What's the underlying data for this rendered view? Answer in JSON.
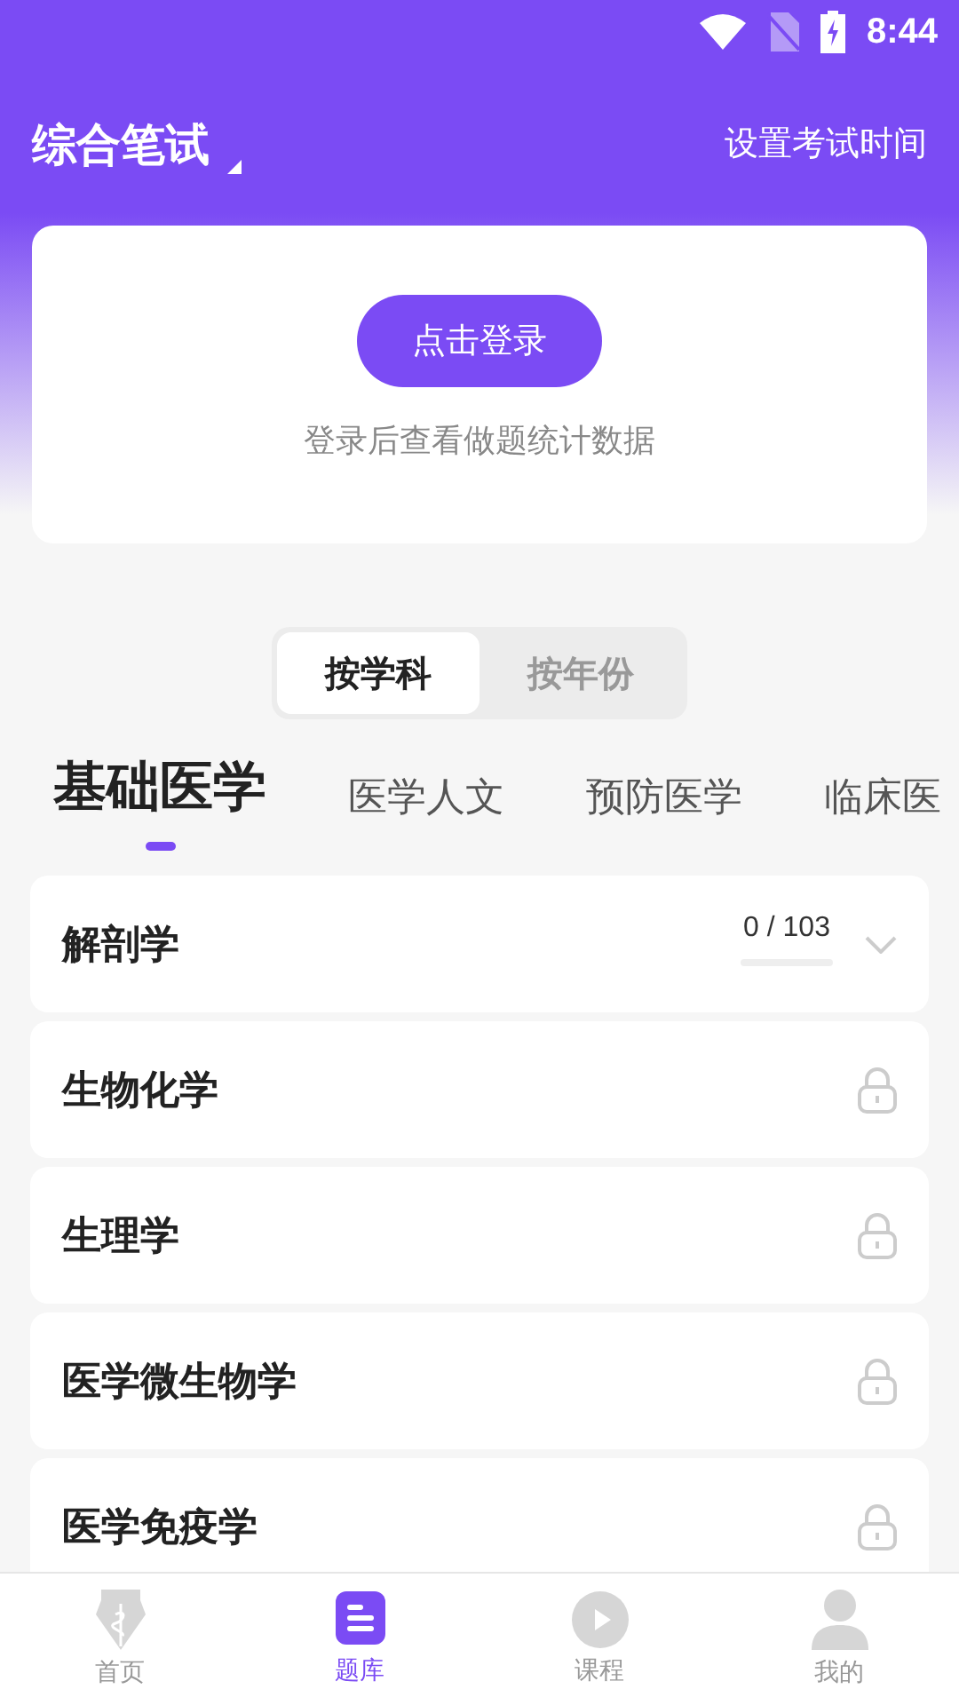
{
  "status_bar": {
    "time": "8:44"
  },
  "header": {
    "title": "综合笔试",
    "action": "设置考试时间"
  },
  "login_card": {
    "button": "点击登录",
    "hint": "登录后查看做题统计数据"
  },
  "mode_toggle": [
    {
      "label": "按学科",
      "selected": true
    },
    {
      "label": "按年份",
      "selected": false
    }
  ],
  "subject_tabs": [
    {
      "label": "基础医学",
      "selected": true
    },
    {
      "label": "医学人文",
      "selected": false
    },
    {
      "label": "预防医学",
      "selected": false
    },
    {
      "label": "临床医",
      "selected": false
    }
  ],
  "subjects": [
    {
      "name": "解剖学",
      "locked": false,
      "progress": "0 / 103",
      "level": 0
    },
    {
      "name": "生物化学",
      "locked": true
    },
    {
      "name": "生理学",
      "locked": true
    },
    {
      "name": "医学微生物学",
      "locked": true
    },
    {
      "name": "医学免疫学",
      "locked": true
    }
  ],
  "bottom_nav": [
    {
      "label": "首页",
      "kind": "pen",
      "selected": false
    },
    {
      "label": "题库",
      "kind": "list",
      "selected": true
    },
    {
      "label": "课程",
      "kind": "play",
      "selected": false
    },
    {
      "label": "我的",
      "kind": "user",
      "selected": false
    }
  ]
}
